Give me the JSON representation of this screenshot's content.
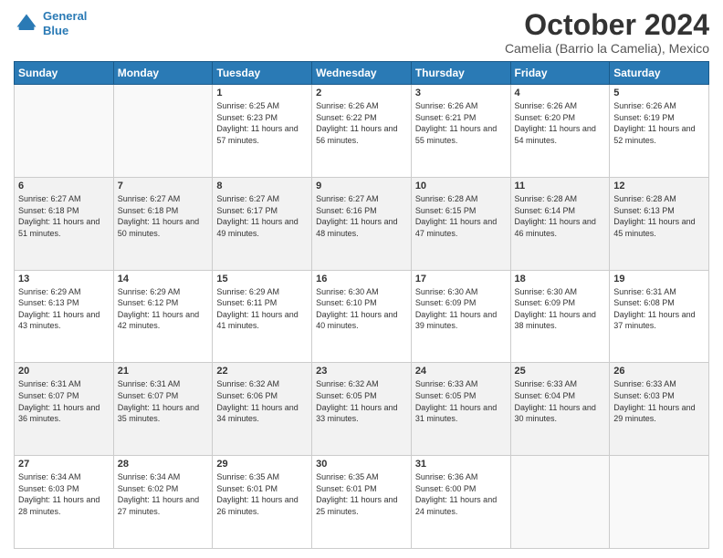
{
  "logo": {
    "line1": "General",
    "line2": "Blue"
  },
  "title": "October 2024",
  "subtitle": "Camelia (Barrio la Camelia), Mexico",
  "days_of_week": [
    "Sunday",
    "Monday",
    "Tuesday",
    "Wednesday",
    "Thursday",
    "Friday",
    "Saturday"
  ],
  "weeks": [
    [
      {
        "day": "",
        "sunrise": "",
        "sunset": "",
        "daylight": ""
      },
      {
        "day": "",
        "sunrise": "",
        "sunset": "",
        "daylight": ""
      },
      {
        "day": "1",
        "sunrise": "Sunrise: 6:25 AM",
        "sunset": "Sunset: 6:23 PM",
        "daylight": "Daylight: 11 hours and 57 minutes."
      },
      {
        "day": "2",
        "sunrise": "Sunrise: 6:26 AM",
        "sunset": "Sunset: 6:22 PM",
        "daylight": "Daylight: 11 hours and 56 minutes."
      },
      {
        "day": "3",
        "sunrise": "Sunrise: 6:26 AM",
        "sunset": "Sunset: 6:21 PM",
        "daylight": "Daylight: 11 hours and 55 minutes."
      },
      {
        "day": "4",
        "sunrise": "Sunrise: 6:26 AM",
        "sunset": "Sunset: 6:20 PM",
        "daylight": "Daylight: 11 hours and 54 minutes."
      },
      {
        "day": "5",
        "sunrise": "Sunrise: 6:26 AM",
        "sunset": "Sunset: 6:19 PM",
        "daylight": "Daylight: 11 hours and 52 minutes."
      }
    ],
    [
      {
        "day": "6",
        "sunrise": "Sunrise: 6:27 AM",
        "sunset": "Sunset: 6:18 PM",
        "daylight": "Daylight: 11 hours and 51 minutes."
      },
      {
        "day": "7",
        "sunrise": "Sunrise: 6:27 AM",
        "sunset": "Sunset: 6:18 PM",
        "daylight": "Daylight: 11 hours and 50 minutes."
      },
      {
        "day": "8",
        "sunrise": "Sunrise: 6:27 AM",
        "sunset": "Sunset: 6:17 PM",
        "daylight": "Daylight: 11 hours and 49 minutes."
      },
      {
        "day": "9",
        "sunrise": "Sunrise: 6:27 AM",
        "sunset": "Sunset: 6:16 PM",
        "daylight": "Daylight: 11 hours and 48 minutes."
      },
      {
        "day": "10",
        "sunrise": "Sunrise: 6:28 AM",
        "sunset": "Sunset: 6:15 PM",
        "daylight": "Daylight: 11 hours and 47 minutes."
      },
      {
        "day": "11",
        "sunrise": "Sunrise: 6:28 AM",
        "sunset": "Sunset: 6:14 PM",
        "daylight": "Daylight: 11 hours and 46 minutes."
      },
      {
        "day": "12",
        "sunrise": "Sunrise: 6:28 AM",
        "sunset": "Sunset: 6:13 PM",
        "daylight": "Daylight: 11 hours and 45 minutes."
      }
    ],
    [
      {
        "day": "13",
        "sunrise": "Sunrise: 6:29 AM",
        "sunset": "Sunset: 6:13 PM",
        "daylight": "Daylight: 11 hours and 43 minutes."
      },
      {
        "day": "14",
        "sunrise": "Sunrise: 6:29 AM",
        "sunset": "Sunset: 6:12 PM",
        "daylight": "Daylight: 11 hours and 42 minutes."
      },
      {
        "day": "15",
        "sunrise": "Sunrise: 6:29 AM",
        "sunset": "Sunset: 6:11 PM",
        "daylight": "Daylight: 11 hours and 41 minutes."
      },
      {
        "day": "16",
        "sunrise": "Sunrise: 6:30 AM",
        "sunset": "Sunset: 6:10 PM",
        "daylight": "Daylight: 11 hours and 40 minutes."
      },
      {
        "day": "17",
        "sunrise": "Sunrise: 6:30 AM",
        "sunset": "Sunset: 6:09 PM",
        "daylight": "Daylight: 11 hours and 39 minutes."
      },
      {
        "day": "18",
        "sunrise": "Sunrise: 6:30 AM",
        "sunset": "Sunset: 6:09 PM",
        "daylight": "Daylight: 11 hours and 38 minutes."
      },
      {
        "day": "19",
        "sunrise": "Sunrise: 6:31 AM",
        "sunset": "Sunset: 6:08 PM",
        "daylight": "Daylight: 11 hours and 37 minutes."
      }
    ],
    [
      {
        "day": "20",
        "sunrise": "Sunrise: 6:31 AM",
        "sunset": "Sunset: 6:07 PM",
        "daylight": "Daylight: 11 hours and 36 minutes."
      },
      {
        "day": "21",
        "sunrise": "Sunrise: 6:31 AM",
        "sunset": "Sunset: 6:07 PM",
        "daylight": "Daylight: 11 hours and 35 minutes."
      },
      {
        "day": "22",
        "sunrise": "Sunrise: 6:32 AM",
        "sunset": "Sunset: 6:06 PM",
        "daylight": "Daylight: 11 hours and 34 minutes."
      },
      {
        "day": "23",
        "sunrise": "Sunrise: 6:32 AM",
        "sunset": "Sunset: 6:05 PM",
        "daylight": "Daylight: 11 hours and 33 minutes."
      },
      {
        "day": "24",
        "sunrise": "Sunrise: 6:33 AM",
        "sunset": "Sunset: 6:05 PM",
        "daylight": "Daylight: 11 hours and 31 minutes."
      },
      {
        "day": "25",
        "sunrise": "Sunrise: 6:33 AM",
        "sunset": "Sunset: 6:04 PM",
        "daylight": "Daylight: 11 hours and 30 minutes."
      },
      {
        "day": "26",
        "sunrise": "Sunrise: 6:33 AM",
        "sunset": "Sunset: 6:03 PM",
        "daylight": "Daylight: 11 hours and 29 minutes."
      }
    ],
    [
      {
        "day": "27",
        "sunrise": "Sunrise: 6:34 AM",
        "sunset": "Sunset: 6:03 PM",
        "daylight": "Daylight: 11 hours and 28 minutes."
      },
      {
        "day": "28",
        "sunrise": "Sunrise: 6:34 AM",
        "sunset": "Sunset: 6:02 PM",
        "daylight": "Daylight: 11 hours and 27 minutes."
      },
      {
        "day": "29",
        "sunrise": "Sunrise: 6:35 AM",
        "sunset": "Sunset: 6:01 PM",
        "daylight": "Daylight: 11 hours and 26 minutes."
      },
      {
        "day": "30",
        "sunrise": "Sunrise: 6:35 AM",
        "sunset": "Sunset: 6:01 PM",
        "daylight": "Daylight: 11 hours and 25 minutes."
      },
      {
        "day": "31",
        "sunrise": "Sunrise: 6:36 AM",
        "sunset": "Sunset: 6:00 PM",
        "daylight": "Daylight: 11 hours and 24 minutes."
      },
      {
        "day": "",
        "sunrise": "",
        "sunset": "",
        "daylight": ""
      },
      {
        "day": "",
        "sunrise": "",
        "sunset": "",
        "daylight": ""
      }
    ]
  ]
}
